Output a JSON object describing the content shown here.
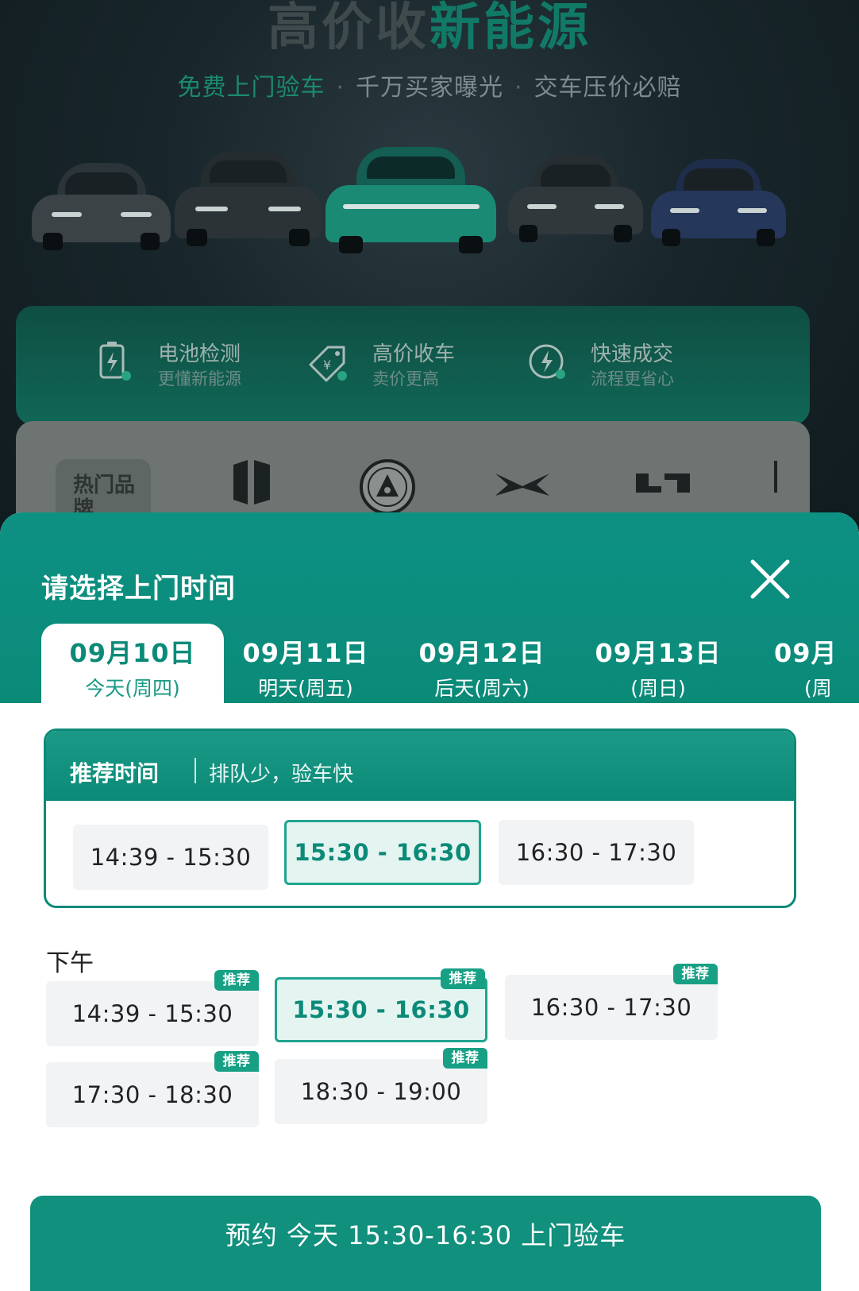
{
  "hero": {
    "title_a": "高价收",
    "title_b": "新能源",
    "subtitle": [
      "免费上门验车",
      "千万买家曝光",
      "交车压价必赔"
    ],
    "subtitle_sep": "·"
  },
  "features": [
    {
      "name": "电池检测",
      "desc": "更懂新能源",
      "icon": "battery-icon"
    },
    {
      "name": "高价收车",
      "desc": "卖价更高",
      "icon": "price-tag-icon"
    },
    {
      "name": "快速成交",
      "desc": "流程更省心",
      "icon": "fast-lightning-icon"
    }
  ],
  "brands": {
    "hot_label": "热门品牌",
    "logos": [
      "leapmotor-logo",
      "hongqi-logo",
      "xpeng-logo",
      "li-auto-logo"
    ]
  },
  "sheet": {
    "title": "请选择上门时间",
    "close_icon": "close-icon",
    "dates": [
      {
        "date": "09月10日",
        "week": "今天(周四)",
        "active": true
      },
      {
        "date": "09月11日",
        "week": "明天(周五)"
      },
      {
        "date": "09月12日",
        "week": "后天(周六)"
      },
      {
        "date": "09月13日",
        "week": "(周日)"
      },
      {
        "date": "09月",
        "week": "(周"
      }
    ],
    "recommended": {
      "title": "推荐时间",
      "note": "排队少，验车快",
      "slots": [
        "14:39 - 15:30",
        "15:30 - 16:30",
        "16:30 - 17:30"
      ],
      "selected_index": 1
    },
    "afternoon": {
      "label": "下午",
      "tag": "推荐",
      "slots": [
        "14:39 - 15:30",
        "15:30 - 16:30",
        "16:30 - 17:30",
        "17:30 - 18:30",
        "18:30 - 19:00"
      ],
      "selected_index": 1
    },
    "book_button": "预约 今天 15:30-16:30 上门验车"
  },
  "colors": {
    "primary": "#0b8a78",
    "accent_light": "#e4f5f1",
    "hero_green": "#117a67"
  }
}
